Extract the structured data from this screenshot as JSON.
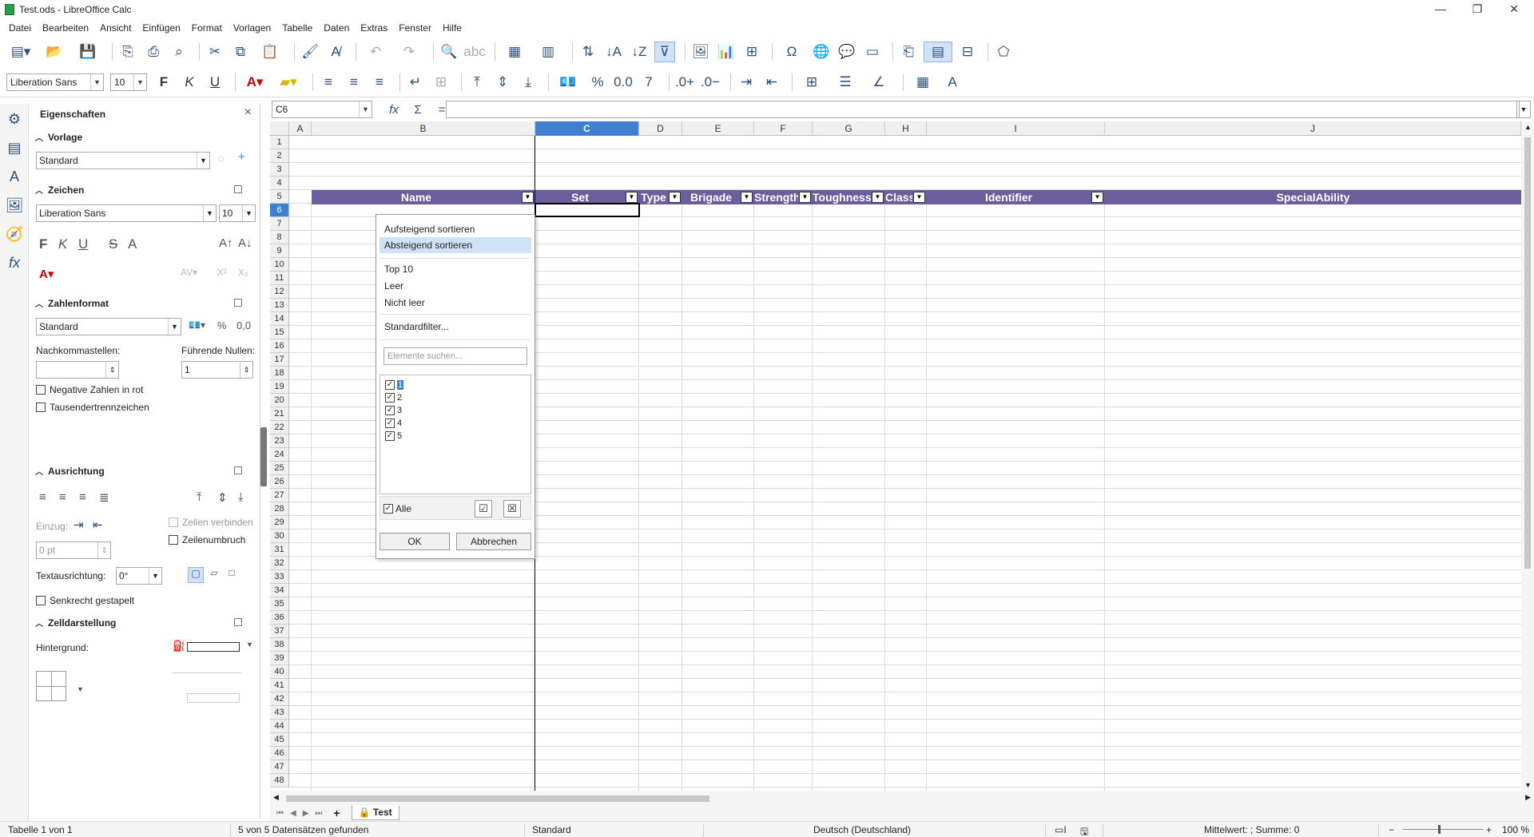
{
  "window": {
    "title": "Test.ods - LibreOffice Calc"
  },
  "menu": [
    "Datei",
    "Bearbeiten",
    "Ansicht",
    "Einfügen",
    "Format",
    "Vorlagen",
    "Tabelle",
    "Daten",
    "Extras",
    "Fenster",
    "Hilfe"
  ],
  "formatting": {
    "font_name": "Liberation Sans",
    "font_size": "10"
  },
  "formula_bar": {
    "name_box": "C6",
    "fx": "fx",
    "sigma": "Σ",
    "equals": "="
  },
  "sidebar": {
    "title": "Eigenschaften",
    "vorlage": {
      "header": "Vorlage",
      "value": "Standard"
    },
    "zeichen": {
      "header": "Zeichen",
      "font": "Liberation Sans",
      "size": "10",
      "bold": "F",
      "italic": "K",
      "underline": "U",
      "strike": "S",
      "shadow": "A"
    },
    "zahlenformat": {
      "header": "Zahlenformat",
      "value": "Standard",
      "nachkomma_label": "Nachkommastellen:",
      "nachkomma_value": "",
      "nullen_label": "Führende Nullen:",
      "nullen_value": "1",
      "negative": "Negative Zahlen in rot",
      "tausender": "Tausendertrennzeichen",
      "percent": "%",
      "decimal": "0,0"
    },
    "ausrichtung": {
      "header": "Ausrichtung",
      "einzug_label": "Einzug:",
      "einzug_value": "0 pt",
      "zellen_verbinden": "Zellen verbinden",
      "zeilenumbruch": "Zeilenumbruch",
      "textrichtung_label": "Textausrichtung:",
      "textrichtung_value": "0°",
      "senkrecht": "Senkrecht gestapelt"
    },
    "zelldarstellung": {
      "header": "Zelldarstellung",
      "hintergrund_label": "Hintergrund:"
    }
  },
  "columns": [
    "A",
    "B",
    "C",
    "D",
    "E",
    "F",
    "G",
    "H",
    "I",
    "J"
  ],
  "selected_column": "C",
  "selected_row": "6",
  "table_header": [
    "Name",
    "Set",
    "Type",
    "Brigade",
    "Strength",
    "Toughness",
    "Class",
    "Identifier",
    "SpecialAbility"
  ],
  "autofilter_popup": {
    "sort_asc": "Aufsteigend sortieren",
    "sort_desc": "Absteigend sortieren",
    "top10": "Top 10",
    "leer": "Leer",
    "nicht_leer": "Nicht leer",
    "standardfilter": "Standardfilter...",
    "search_placeholder": "Elemente suchen...",
    "values": [
      "1",
      "2",
      "3",
      "4",
      "5"
    ],
    "alle": "Alle",
    "ok": "OK",
    "abbrechen": "Abbrechen"
  },
  "sheet_tabs": {
    "active": "Test"
  },
  "status": {
    "sheet": "Tabelle 1 von 1",
    "records": "5 von 5 Datensätzen gefunden",
    "style": "Standard",
    "language": "Deutsch (Deutschland)",
    "summary": "Mittelwert: ; Summe: 0",
    "zoom": "100 %"
  }
}
